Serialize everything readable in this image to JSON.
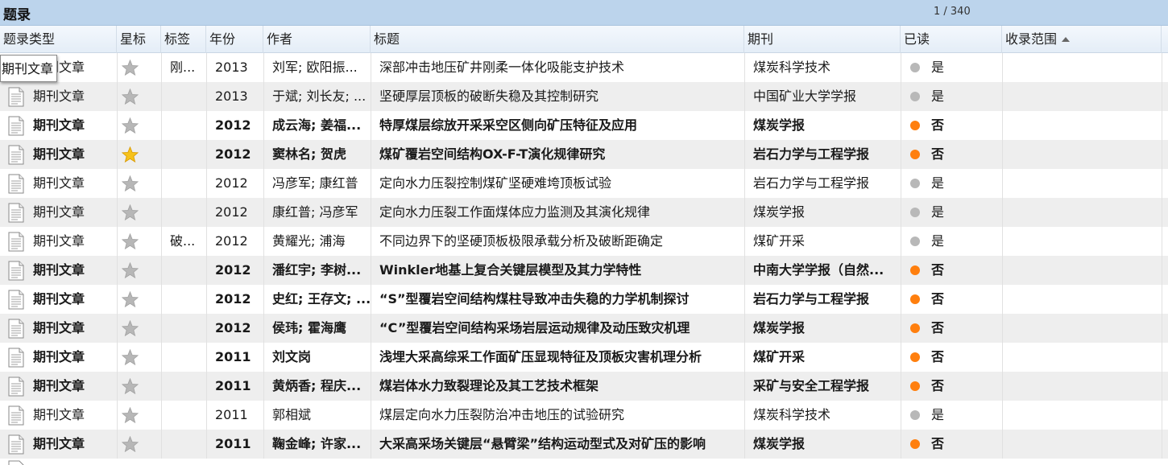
{
  "window": {
    "title": "题录",
    "pager": "1 / 340"
  },
  "columns": [
    "题录类型",
    "星标",
    "标签",
    "年份",
    "作者",
    "标题",
    "期刊",
    "已读",
    "收录范围"
  ],
  "tooltip": "期刊文章",
  "colors": {
    "unread_dot": "#ff7f0e",
    "read_dot": "#b8b8b8",
    "star_on": "#f6c21b",
    "star_off": "#b7b7b7"
  },
  "rows": [
    {
      "type": "期刊文章",
      "starred": false,
      "tag": "刚...",
      "year": "2013",
      "author": "刘军; 欧阳振...",
      "title": "深部冲击地压矿井刚柔一体化吸能支护技术",
      "journal": "煤炭科学技术",
      "read": "是",
      "bold": false
    },
    {
      "type": "期刊文章",
      "starred": false,
      "tag": "",
      "year": "2013",
      "author": "于斌; 刘长友; ...",
      "title": "坚硬厚层顶板的破断失稳及其控制研究",
      "journal": "中国矿业大学学报",
      "read": "是",
      "bold": false
    },
    {
      "type": "期刊文章",
      "starred": false,
      "tag": "",
      "year": "2012",
      "author": "成云海; 姜福...",
      "title": "特厚煤层综放开采采空区侧向矿压特征及应用",
      "journal": "煤炭学报",
      "read": "否",
      "bold": true
    },
    {
      "type": "期刊文章",
      "starred": true,
      "tag": "",
      "year": "2012",
      "author": "窦林名; 贺虎",
      "title": "煤矿覆岩空间结构OX-F-T演化规律研究",
      "journal": "岩石力学与工程学报",
      "read": "否",
      "bold": true
    },
    {
      "type": "期刊文章",
      "starred": false,
      "tag": "",
      "year": "2012",
      "author": "冯彦军; 康红普",
      "title": "定向水力压裂控制煤矿坚硬难垮顶板试验",
      "journal": "岩石力学与工程学报",
      "read": "是",
      "bold": false
    },
    {
      "type": "期刊文章",
      "starred": false,
      "tag": "",
      "year": "2012",
      "author": "康红普; 冯彦军",
      "title": "定向水力压裂工作面煤体应力监测及其演化规律",
      "journal": "煤炭学报",
      "read": "是",
      "bold": false
    },
    {
      "type": "期刊文章",
      "starred": false,
      "tag": "破...",
      "year": "2012",
      "author": "黄耀光; 浦海",
      "title": "不同边界下的坚硬顶板极限承载分析及破断距确定",
      "journal": "煤矿开采",
      "read": "是",
      "bold": false
    },
    {
      "type": "期刊文章",
      "starred": false,
      "tag": "",
      "year": "2012",
      "author": "潘红宇; 李树...",
      "title": "Winkler地基上复合关键层模型及其力学特性",
      "journal": "中南大学学报（自然...",
      "read": "否",
      "bold": true
    },
    {
      "type": "期刊文章",
      "starred": false,
      "tag": "",
      "year": "2012",
      "author": "史红; 王存文; ...",
      "title": "“S”型覆岩空间结构煤柱导致冲击失稳的力学机制探讨",
      "journal": "岩石力学与工程学报",
      "read": "否",
      "bold": true
    },
    {
      "type": "期刊文章",
      "starred": false,
      "tag": "",
      "year": "2012",
      "author": "侯玮; 霍海鹰",
      "title": "“C”型覆岩空间结构采场岩层运动规律及动压致灾机理",
      "journal": "煤炭学报",
      "read": "否",
      "bold": true
    },
    {
      "type": "期刊文章",
      "starred": false,
      "tag": "",
      "year": "2011",
      "author": "刘文岗",
      "title": "浅埋大采高综采工作面矿压显现特征及顶板灾害机理分析",
      "journal": "煤矿开采",
      "read": "否",
      "bold": true
    },
    {
      "type": "期刊文章",
      "starred": false,
      "tag": "",
      "year": "2011",
      "author": "黄炳香; 程庆...",
      "title": "煤岩体水力致裂理论及其工艺技术框架",
      "journal": "采矿与安全工程学报",
      "read": "否",
      "bold": true
    },
    {
      "type": "期刊文章",
      "starred": false,
      "tag": "",
      "year": "2011",
      "author": "郭相斌",
      "title": "煤层定向水力压裂防治冲击地压的试验研究",
      "journal": "煤炭科学技术",
      "read": "是",
      "bold": false
    },
    {
      "type": "期刊文章",
      "starred": false,
      "tag": "",
      "year": "2011",
      "author": "鞠金峰; 许家...",
      "title": "大采高采场关键层“悬臂梁”结构运动型式及对矿压的影响",
      "journal": "煤炭学报",
      "read": "否",
      "bold": true
    }
  ]
}
